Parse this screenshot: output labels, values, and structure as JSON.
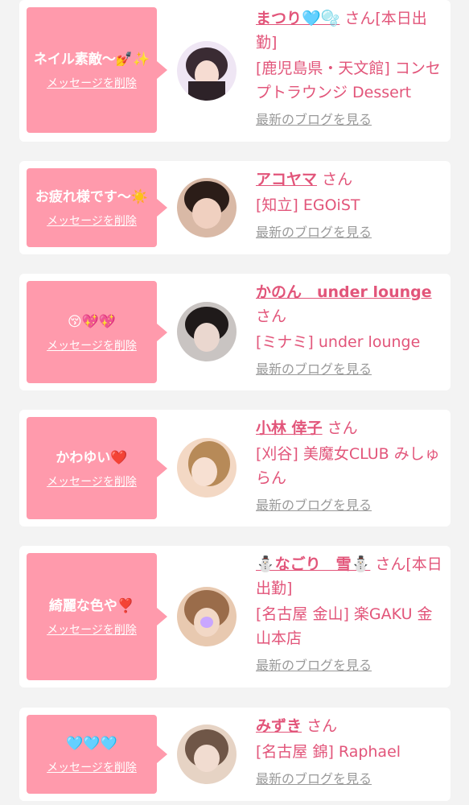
{
  "items": [
    {
      "message": "ネイル素敵〜💅✨",
      "delete_label": "メッセージを削除",
      "name": "まつり🩵🫧",
      "suffix": "さん[本日出勤]",
      "shop": "[鹿児島県・天文館] コンセプトラウンジ Dessert",
      "blog_label": "最新のブログを見る",
      "avatar_colors": [
        "#efe6f4",
        "#3a2b33"
      ]
    },
    {
      "message": "お疲れ様です〜☀️",
      "delete_label": "メッセージを削除",
      "name": "アコヤマ",
      "suffix": "さん",
      "shop": "[知立] EGOiST",
      "blog_label": "最新のブログを見る",
      "avatar_colors": [
        "#d9b9a6",
        "#2b1d18"
      ]
    },
    {
      "message": "😚💖💖",
      "delete_label": "メッセージを削除",
      "name": "かのん　under lounge",
      "suffix": "さん",
      "shop": "[ミナミ] under lounge",
      "blog_label": "最新のブログを見る",
      "avatar_colors": [
        "#c9c4c2",
        "#1f1a1a"
      ]
    },
    {
      "message": "かわゆい❤️",
      "delete_label": "メッセージを削除",
      "name": "小林 倖子",
      "suffix": "さん",
      "shop": "[刈谷] 美魔女CLUB みしゅらん",
      "blog_label": "最新のブログを見る",
      "avatar_colors": [
        "#f3d8c4",
        "#b78a58"
      ]
    },
    {
      "message": "綺麗な色や❣️",
      "delete_label": "メッセージを削除",
      "name": "⛄なごり　雪⛄",
      "suffix": "さん[本日出勤]",
      "shop": "[名古屋 金山] 楽GAKU 金山本店",
      "blog_label": "最新のブログを見る",
      "avatar_colors": [
        "#e8c9b0",
        "#9a6c4a"
      ]
    },
    {
      "message": "🩵🩵🩵",
      "delete_label": "メッセージを削除",
      "name": "みずき",
      "suffix": "さん",
      "shop": "[名古屋 錦] Raphael",
      "blog_label": "最新のブログを見る",
      "avatar_colors": [
        "#e6d3c4",
        "#6f5647"
      ]
    }
  ]
}
